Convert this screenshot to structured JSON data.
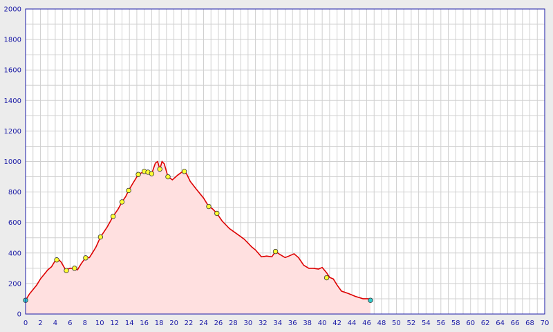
{
  "chart_data": {
    "type": "area",
    "title": "",
    "xlabel": "",
    "ylabel": "",
    "xlim": [
      0,
      70
    ],
    "ylim": [
      0,
      2000
    ],
    "x_ticks": [
      "0",
      "2",
      "4",
      "6",
      "8",
      "10",
      "12",
      "14",
      "16",
      "18",
      "20",
      "22",
      "24",
      "26",
      "28",
      "30",
      "32",
      "34",
      "36",
      "38",
      "40",
      "42",
      "44",
      "46",
      "48",
      "50",
      "52",
      "54",
      "56",
      "58",
      "60",
      "62",
      "64",
      "66",
      "68",
      "70"
    ],
    "y_ticks": [
      "0",
      "200",
      "400",
      "600",
      "800",
      "1000",
      "1200",
      "1400",
      "1600",
      "1800",
      "2000"
    ],
    "grid": true,
    "colors": {
      "line": "#dd0000",
      "fill": "#ffe0e0",
      "waypoint": "#ffff33",
      "endpoint": "#33cccc",
      "axis_text": "#1a1aa6",
      "grid": "#d0d0d0",
      "frame": "#1a1aa6"
    },
    "profile": [
      [
        0,
        90
      ],
      [
        0.5,
        130
      ],
      [
        1,
        160
      ],
      [
        1.5,
        190
      ],
      [
        2,
        230
      ],
      [
        2.5,
        260
      ],
      [
        3,
        290
      ],
      [
        3.5,
        310
      ],
      [
        4,
        350
      ],
      [
        4.4,
        360
      ],
      [
        4.8,
        340
      ],
      [
        5.4,
        290
      ],
      [
        6,
        300
      ],
      [
        6.5,
        300
      ],
      [
        7,
        290
      ],
      [
        7.5,
        330
      ],
      [
        8.1,
        370
      ],
      [
        8.6,
        370
      ],
      [
        9,
        400
      ],
      [
        9.5,
        440
      ],
      [
        10.1,
        505
      ],
      [
        11,
        570
      ],
      [
        11.8,
        640
      ],
      [
        12.5,
        690
      ],
      [
        13,
        735
      ],
      [
        13.5,
        770
      ],
      [
        13.9,
        810
      ],
      [
        14.5,
        860
      ],
      [
        15.2,
        915
      ],
      [
        16,
        935
      ],
      [
        16.5,
        930
      ],
      [
        17,
        920
      ],
      [
        17.5,
        990
      ],
      [
        17.8,
        1000
      ],
      [
        18.1,
        950
      ],
      [
        18.4,
        1000
      ],
      [
        18.7,
        985
      ],
      [
        19.2,
        900
      ],
      [
        19.8,
        880
      ],
      [
        20.5,
        910
      ],
      [
        21.2,
        935
      ],
      [
        21.7,
        920
      ],
      [
        22.2,
        870
      ],
      [
        23,
        820
      ],
      [
        24,
        760
      ],
      [
        24.7,
        705
      ],
      [
        25.2,
        690
      ],
      [
        25.8,
        660
      ],
      [
        26.5,
        610
      ],
      [
        27.5,
        560
      ],
      [
        28.5,
        525
      ],
      [
        29.5,
        490
      ],
      [
        30.5,
        440
      ],
      [
        31,
        420
      ],
      [
        31.8,
        375
      ],
      [
        32.5,
        380
      ],
      [
        33.2,
        375
      ],
      [
        33.7,
        410
      ],
      [
        34.3,
        390
      ],
      [
        35,
        370
      ],
      [
        35.5,
        380
      ],
      [
        36.2,
        395
      ],
      [
        36.8,
        370
      ],
      [
        37.5,
        320
      ],
      [
        38.2,
        300
      ],
      [
        38.8,
        300
      ],
      [
        39.5,
        295
      ],
      [
        40,
        305
      ],
      [
        40.6,
        270
      ],
      [
        41,
        240
      ],
      [
        41.5,
        230
      ],
      [
        42,
        190
      ],
      [
        42.6,
        150
      ],
      [
        43.5,
        135
      ],
      [
        44.5,
        115
      ],
      [
        45.5,
        100
      ],
      [
        46.2,
        100
      ],
      [
        46.5,
        90
      ]
    ],
    "waypoints": [
      [
        4.2,
        355
      ],
      [
        5.5,
        285
      ],
      [
        6.6,
        300
      ],
      [
        8.1,
        368
      ],
      [
        10.1,
        505
      ],
      [
        11.8,
        640
      ],
      [
        13,
        735
      ],
      [
        13.9,
        810
      ],
      [
        15.2,
        915
      ],
      [
        16,
        935
      ],
      [
        16.5,
        930
      ],
      [
        17,
        920
      ],
      [
        18.1,
        950
      ],
      [
        19.2,
        900
      ],
      [
        21.4,
        935
      ],
      [
        24.7,
        705
      ],
      [
        25.8,
        660
      ],
      [
        33.7,
        410
      ],
      [
        40.6,
        238
      ]
    ],
    "endpoints": [
      [
        0,
        90
      ],
      [
        46.5,
        90
      ]
    ]
  }
}
